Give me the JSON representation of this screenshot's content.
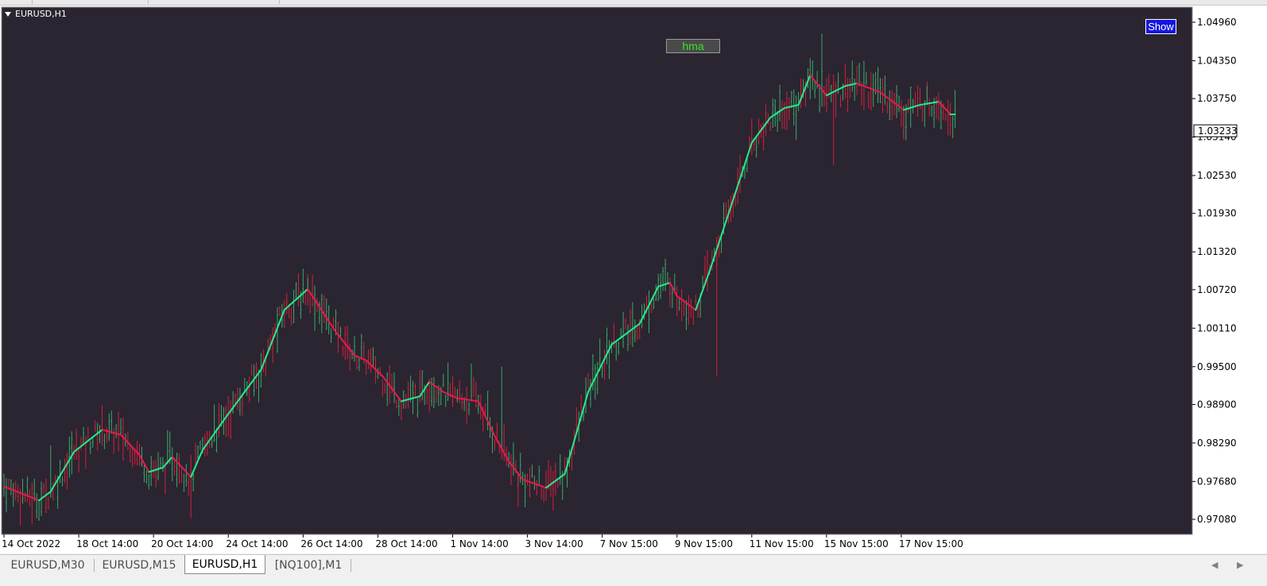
{
  "window": {
    "symbol": "EURUSD,H1",
    "background": "#2a2530",
    "grid": false
  },
  "buttons": {
    "indicator_label": "hma",
    "show_label": "Show"
  },
  "tabs": [
    {
      "label": "EURUSD,M30",
      "active": false
    },
    {
      "label": "EURUSD,M15",
      "active": false
    },
    {
      "label": "EURUSD,H1",
      "active": true
    },
    {
      "label": "[NQ100],M1",
      "active": false
    }
  ],
  "nav": {
    "left_icon": "triangle-left-icon",
    "right_icon": "triangle-right-icon"
  },
  "colors": {
    "bull_bar": "#3aa86a",
    "bear_bar": "#d0203e",
    "hma_up": "#29e88c",
    "hma_down": "#e8194c",
    "axis_text": "#ffffff",
    "price_label_bg": "#ffffff"
  },
  "chart_data": {
    "type": "line",
    "chart_subtype": "OHLC bar chart with Hull Moving Average overlay",
    "symbol": "EURUSD",
    "timeframe": "H1",
    "y_ticks": [
      1.0496,
      1.0435,
      1.0375,
      1.0314,
      1.0253,
      1.0193,
      1.0132,
      1.0072,
      1.0011,
      0.995,
      0.989,
      0.9829,
      0.9768,
      0.9708
    ],
    "y_tick_labels": [
      "1.04960",
      "1.04350",
      "1.03750",
      "1.03140",
      "1.02530",
      "1.01930",
      "1.01320",
      "1.00720",
      "1.00110",
      "0.99500",
      "0.98900",
      "0.98290",
      "0.97680",
      "0.97080"
    ],
    "ylim": [
      0.9693,
      1.05
    ],
    "current_price": "1.03233",
    "x_tick_labels": [
      "14 Oct 2022",
      "18 Oct 14:00",
      "20 Oct 14:00",
      "24 Oct 14:00",
      "26 Oct 14:00",
      "28 Oct 14:00",
      "1 Nov 14:00",
      "3 Nov 14:00",
      "7 Nov 15:00",
      "9 Nov 15:00",
      "11 Nov 15:00",
      "15 Nov 15:00",
      "17 Nov 15:00"
    ],
    "x_ticks_bar_index": [
      0,
      32,
      64,
      96,
      128,
      160,
      192,
      224,
      256,
      288,
      320,
      352,
      384
    ],
    "bar_count": 408,
    "series": [
      {
        "name": "hma",
        "kind": "line",
        "anchors_bar_index": [
          0,
          15,
          20,
          30,
          42,
          50,
          58,
          62,
          68,
          72,
          80,
          85,
          95,
          110,
          120,
          130,
          142,
          150,
          155,
          162,
          170,
          178,
          182,
          188,
          194,
          203,
          210,
          216,
          222,
          232,
          240,
          250,
          260,
          272,
          280,
          285,
          288,
          296,
          302,
          315,
          320,
          328,
          334,
          340,
          345,
          352,
          360,
          365,
          375,
          385,
          392,
          400,
          405
        ],
        "values": [
          0.976,
          0.9738,
          0.9752,
          0.9815,
          0.985,
          0.9842,
          0.981,
          0.9783,
          0.979,
          0.9807,
          0.9775,
          0.9818,
          0.987,
          0.9945,
          1.004,
          1.0073,
          1.0005,
          0.9968,
          0.996,
          0.9935,
          0.9895,
          0.9903,
          0.9926,
          0.991,
          0.99,
          0.9895,
          0.984,
          0.98,
          0.9771,
          0.9758,
          0.978,
          0.991,
          0.9985,
          1.0018,
          1.0077,
          1.0083,
          1.0062,
          1.004,
          1.0102,
          1.0248,
          1.0305,
          1.0345,
          1.036,
          1.0365,
          1.0412,
          1.038,
          1.0395,
          1.0399,
          1.0385,
          1.0357,
          1.0365,
          1.037,
          1.035
        ]
      }
    ],
    "ohlc_anchor_highs": [
      {
        "bar": 0,
        "high": 0.978
      },
      {
        "bar": 20,
        "high": 0.9825
      },
      {
        "bar": 40,
        "high": 0.986
      },
      {
        "bar": 90,
        "high": 0.989
      },
      {
        "bar": 130,
        "high": 1.009
      },
      {
        "bar": 200,
        "high": 0.9955
      },
      {
        "bar": 213,
        "high": 0.995
      },
      {
        "bar": 240,
        "high": 0.978
      },
      {
        "bar": 270,
        "high": 1.0025
      },
      {
        "bar": 282,
        "high": 1.0095
      },
      {
        "bar": 330,
        "high": 1.0365
      },
      {
        "bar": 350,
        "high": 1.0478
      },
      {
        "bar": 368,
        "high": 1.0435
      },
      {
        "bar": 395,
        "high": 1.0395
      }
    ],
    "ohlc_anchor_lows": [
      {
        "bar": 10,
        "high": 0.9735
      },
      {
        "bar": 80,
        "high": 0.971
      },
      {
        "bar": 220,
        "high": 0.9728
      },
      {
        "bar": 305,
        "high": 0.9935
      },
      {
        "bar": 355,
        "high": 1.027
      },
      {
        "bar": 385,
        "high": 1.031
      }
    ]
  }
}
